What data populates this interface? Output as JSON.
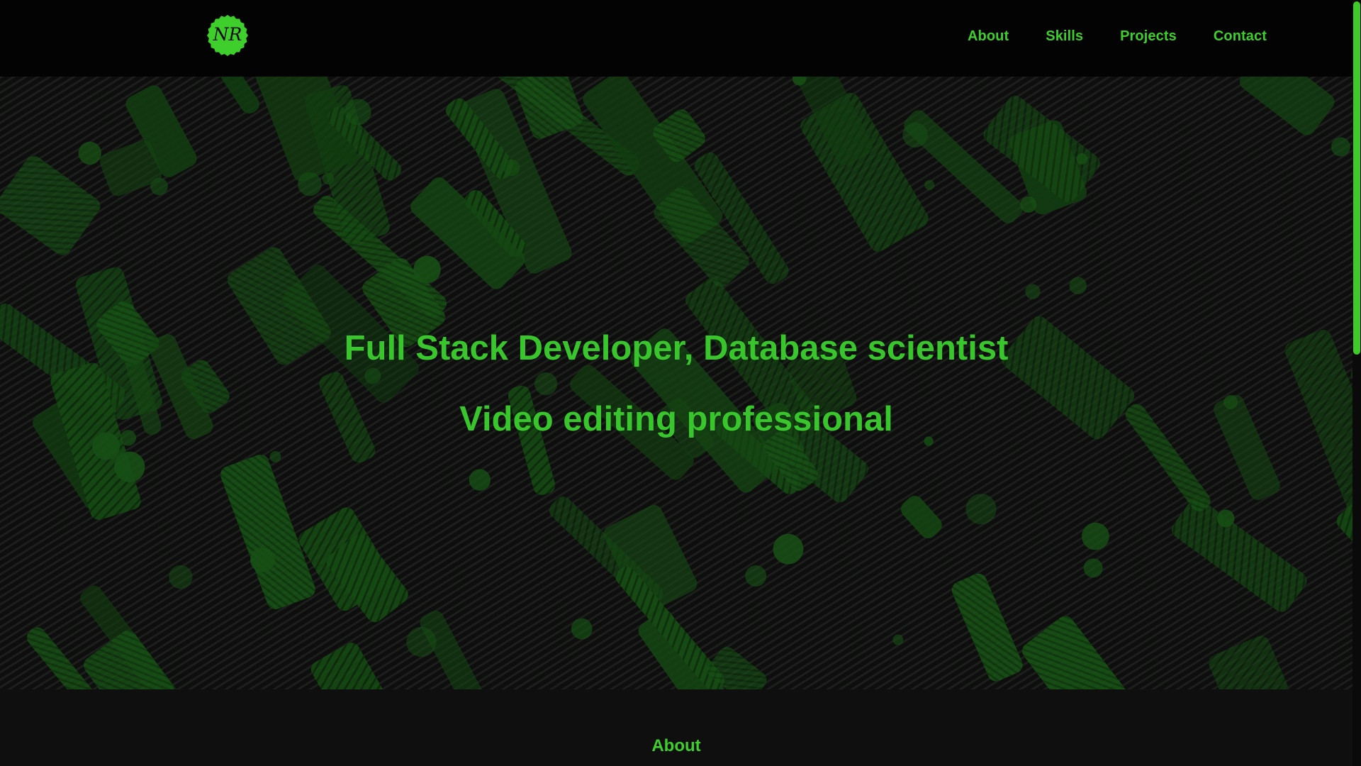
{
  "navbar": {
    "logo_text": "NR",
    "links": [
      {
        "label": "About"
      },
      {
        "label": "Skills"
      },
      {
        "label": "Projects"
      },
      {
        "label": "Contact"
      }
    ]
  },
  "hero": {
    "line1": "Full Stack Developer, Database scientist",
    "line2": "Video editing professional"
  },
  "about": {
    "heading": "About"
  },
  "colors": {
    "accent": "#3fcf2c",
    "background": "#030303",
    "section_background": "#0f0f0f"
  },
  "scrollbar": {
    "position_fraction": 0.0
  }
}
